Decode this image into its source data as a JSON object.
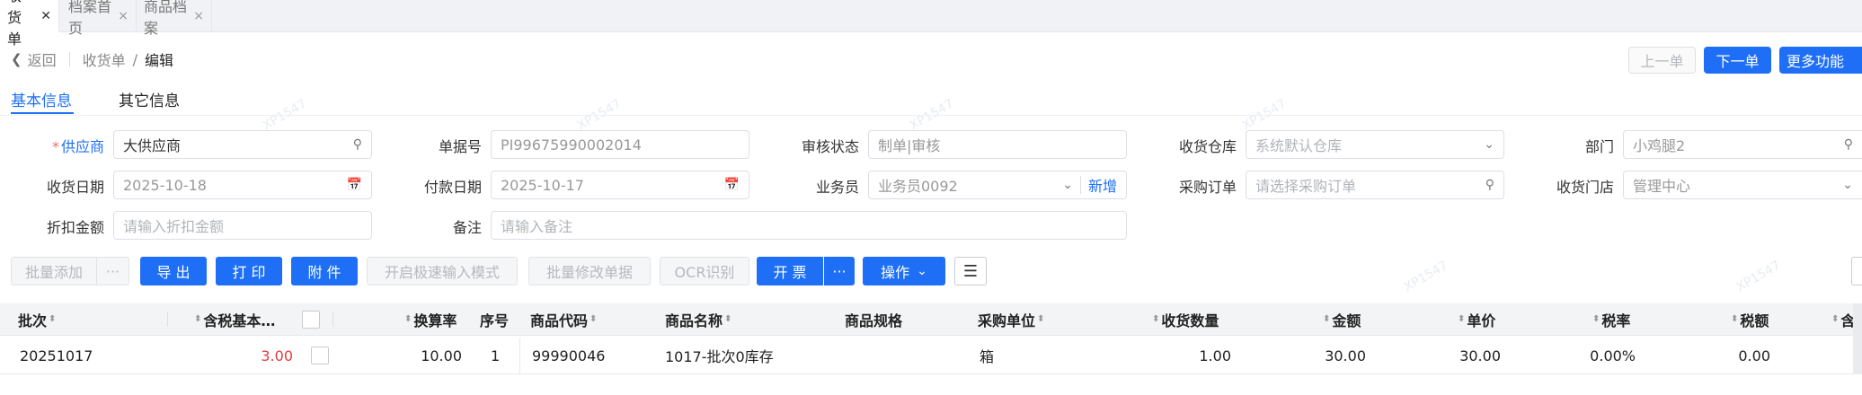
{
  "tabs": [
    {
      "label": "收货单",
      "close": "✕"
    },
    {
      "label": "档案首页",
      "close": "×"
    },
    {
      "label": "商品档案",
      "close": "×"
    }
  ],
  "nav": {
    "back": "返回",
    "crumb_parent": "收货单",
    "crumb_sep": "/",
    "crumb_current": "编辑"
  },
  "top_actions": {
    "prev": "上一单",
    "next": "下一单",
    "more": "更多功能"
  },
  "subtabs": {
    "basic": "基本信息",
    "other": "其它信息"
  },
  "form": {
    "supplier": {
      "label": "供应商",
      "required_mark": "*",
      "value": "大供应商"
    },
    "doc_no": {
      "label": "单据号",
      "value": "PI99675990002014"
    },
    "audit_status": {
      "label": "审核状态",
      "value": "制单|审核"
    },
    "warehouse": {
      "label": "收货仓库",
      "placeholder": "系统默认仓库"
    },
    "department": {
      "label": "部门",
      "value": "小鸡腿2"
    },
    "receive_date": {
      "label": "收货日期",
      "value": "2025-10-18"
    },
    "pay_date": {
      "label": "付款日期",
      "value": "2025-10-17"
    },
    "salesman": {
      "label": "业务员",
      "value": "业务员0092",
      "add": "新增"
    },
    "purchase_order": {
      "label": "采购订单",
      "placeholder": "请选择采购订单"
    },
    "store": {
      "label": "收货门店",
      "value": "管理中心"
    },
    "discount": {
      "label": "折扣金额",
      "placeholder": "请输入折扣金额"
    },
    "remark": {
      "label": "备注",
      "placeholder": "请输入备注"
    }
  },
  "toolbar": {
    "batch_add": "批量添加",
    "more_dots": "···",
    "export": "导 出",
    "print": "打 印",
    "attach": "附 件",
    "fast_input": "开启极速输入模式",
    "batch_edit": "批量修改单据",
    "ocr": "OCR识别",
    "invoice": "开 票",
    "operate": "操作"
  },
  "table": {
    "headers": [
      "批次",
      "含税基本…",
      "换算率",
      "序号",
      "商品代码",
      "商品名称",
      "商品规格",
      "采购单位",
      "收货数量",
      "金额",
      "单价",
      "税率",
      "税额",
      "含"
    ],
    "rows": [
      {
        "batch": "20251017",
        "tax_base": "3.00",
        "rate": "10.00",
        "seq": "1",
        "code": "99990046",
        "name": "1017-批次0库存",
        "spec": "",
        "unit": "箱",
        "qty": "1.00",
        "amount": "30.00",
        "price": "30.00",
        "tax_rate": "0.00%",
        "tax": "0.00"
      }
    ]
  },
  "watermark": "XP1547",
  "colors": {
    "primary": "#1e6ff5",
    "danger": "#e23b3b",
    "required": "#f56c6c"
  }
}
